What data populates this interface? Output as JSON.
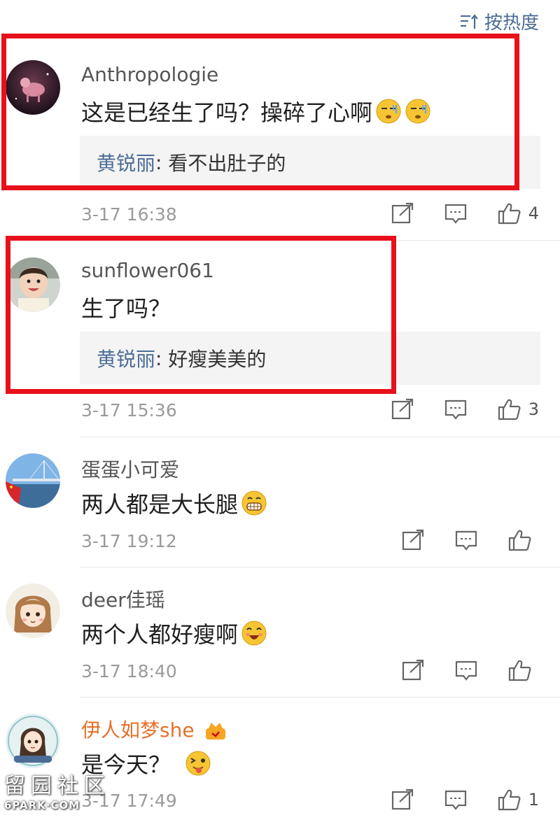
{
  "sort": {
    "label": "按热度"
  },
  "comments": [
    {
      "username": "Anthropologie",
      "text": "这是已经生了吗？操碎了心啊",
      "emojis": [
        "sweat-face-emoji",
        "sweat-face-emoji"
      ],
      "reply": {
        "name": "黄锐丽",
        "sep": ":",
        "text": "看不出肚子的"
      },
      "time": "3-17 16:38",
      "likes": "4"
    },
    {
      "username": "sunflower061",
      "text": "生了吗？",
      "reply": {
        "name": "黄锐丽",
        "sep": ":",
        "text": "好瘦美美的"
      },
      "time": "3-17 15:36",
      "likes": "3"
    },
    {
      "username": "蛋蛋小可爱",
      "text": "两人都是大长腿",
      "emojis": [
        "grin-face-emoji"
      ],
      "time": "3-17 19:12",
      "likes": ""
    },
    {
      "username": "deer佳瑶",
      "text": "两个人都好瘦啊",
      "emojis": [
        "happy-face-emoji"
      ],
      "time": "3-17 18:40",
      "likes": ""
    },
    {
      "username": "伊人如梦she",
      "text": "是今天？",
      "emojis": [
        "wink-tongue-emoji"
      ],
      "time": "3-17 17:49",
      "likes": "1"
    }
  ],
  "colors": {
    "accent": "#4b6c95",
    "highlight": "#e8101a",
    "vip_name": "#e8702a"
  },
  "watermark": {
    "cn": "留园社区",
    "en": "6PARK·COM"
  }
}
